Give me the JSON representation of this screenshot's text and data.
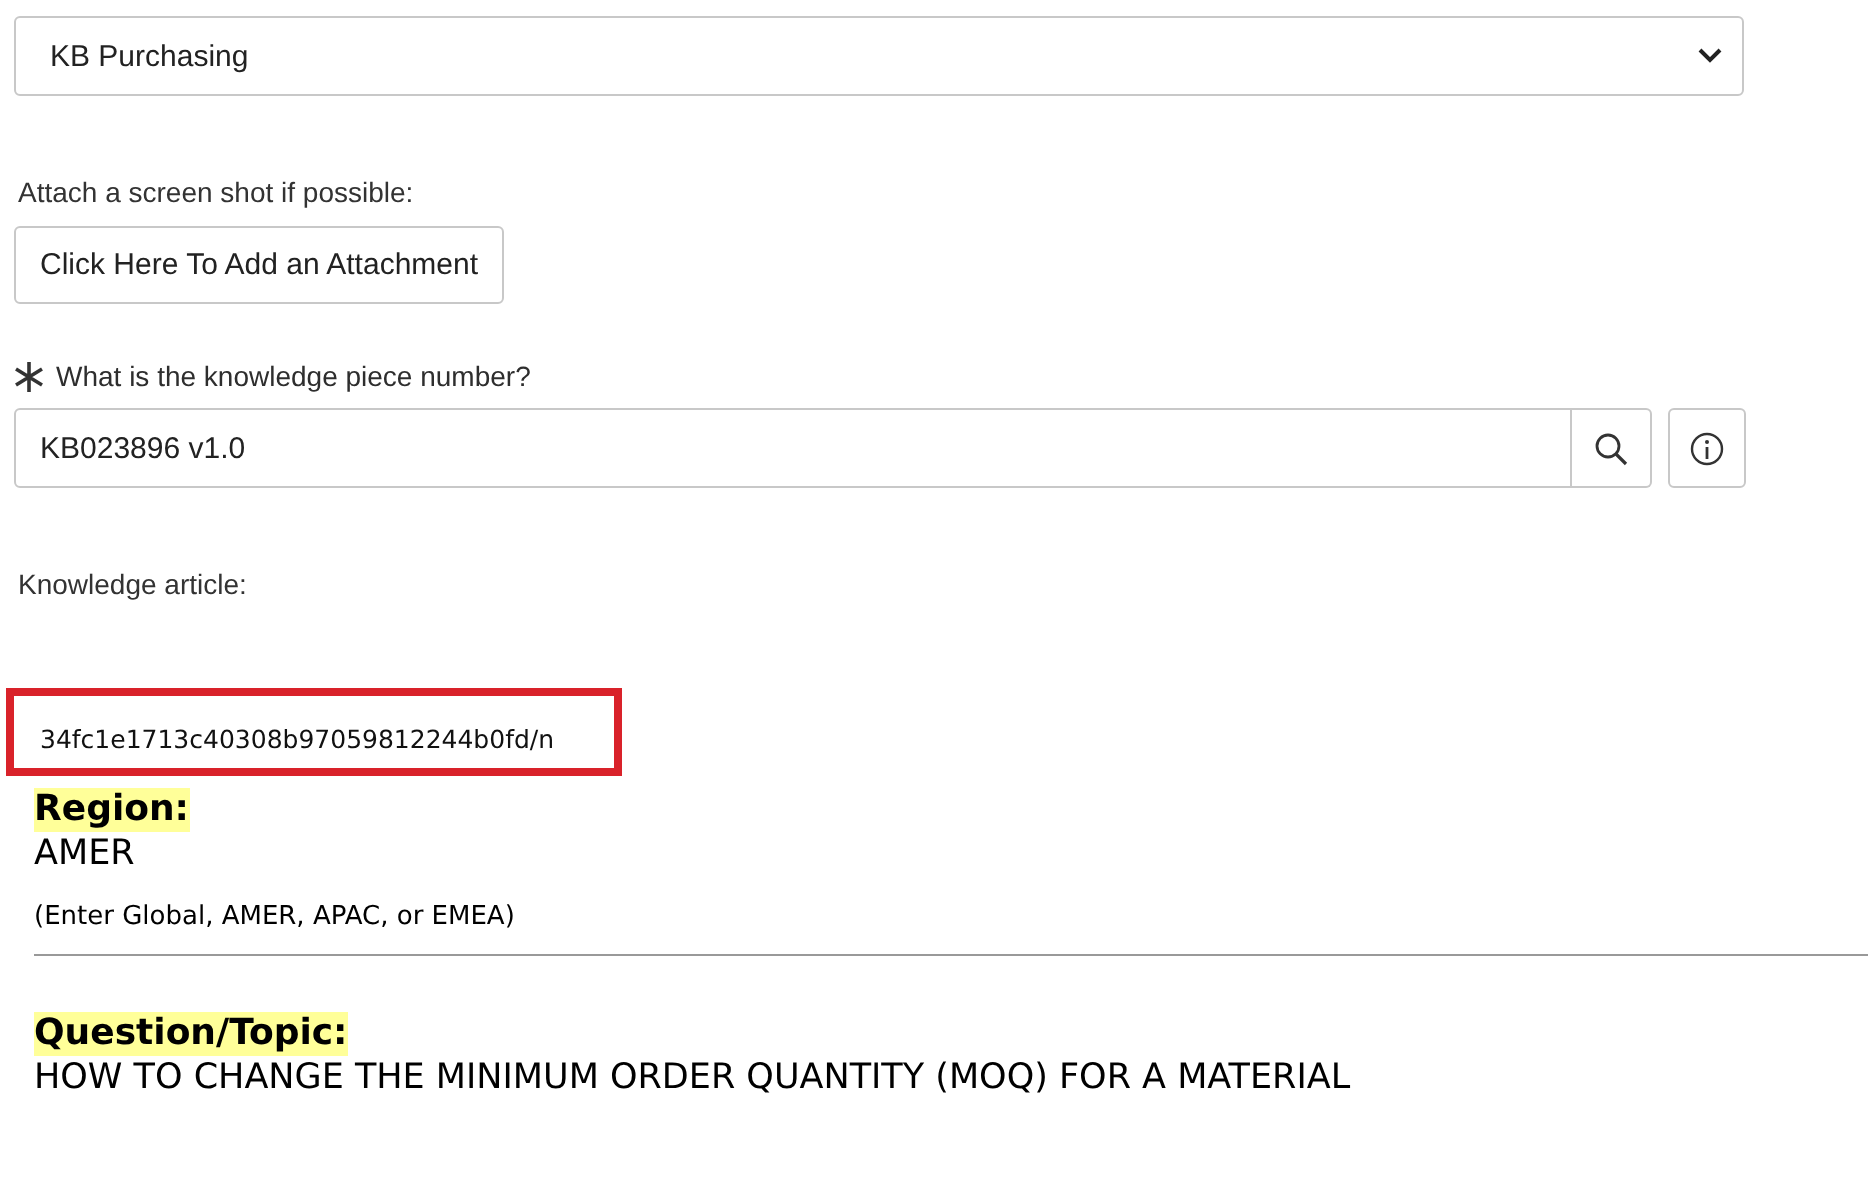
{
  "category_select": {
    "value": "KB Purchasing"
  },
  "attachment": {
    "label": "Attach a screen shot if possible:",
    "button": "Click Here To Add an Attachment"
  },
  "knowledge_piece": {
    "label": "What is the knowledge piece number?",
    "required": true,
    "value": "KB023896 v1.0"
  },
  "knowledge_article": {
    "label": "Knowledge article:",
    "id_text": "34fc1e1713c40308b97059812244b0fd/n",
    "highlighted": true,
    "sections": [
      {
        "heading": "Region:",
        "value": "AMER",
        "hint": "(Enter Global, AMER, APAC, or EMEA)"
      },
      {
        "heading": "Question/Topic:",
        "value": "HOW TO CHANGE THE MINIMUM ORDER QUANTITY (MOQ) FOR A MATERIAL"
      }
    ]
  }
}
